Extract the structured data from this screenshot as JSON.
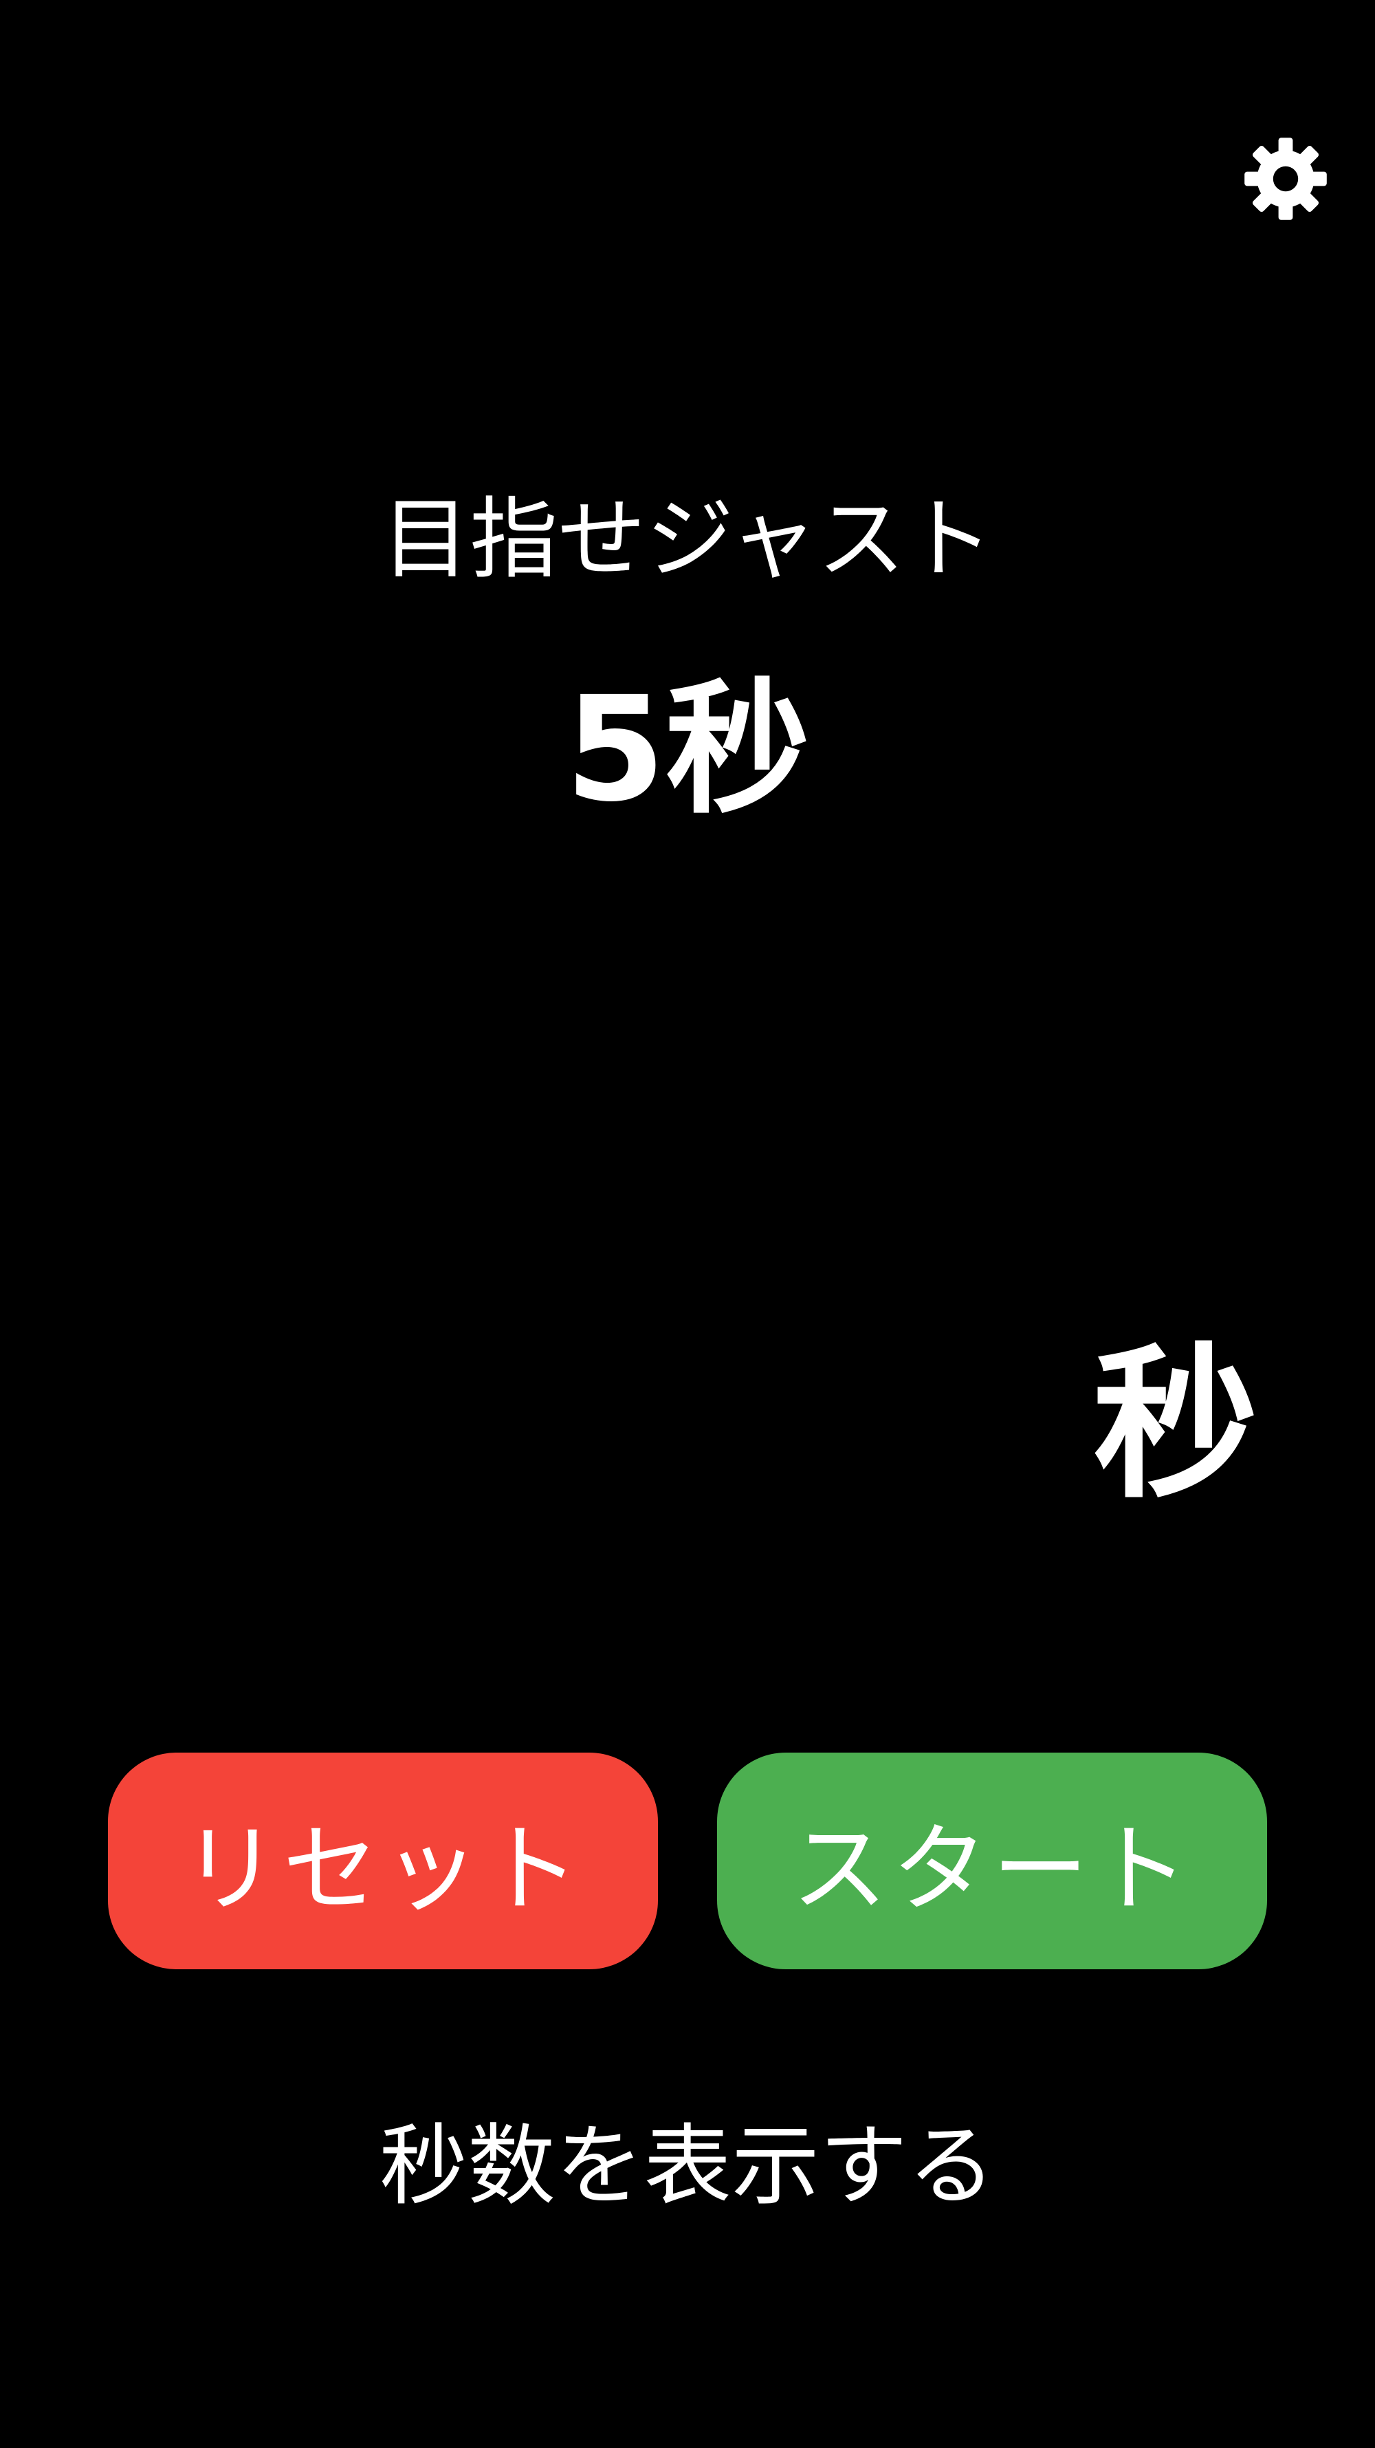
{
  "settings": {
    "icon": "gear-icon"
  },
  "goal": {
    "label": "目指せジャスト",
    "value": "5秒"
  },
  "timer": {
    "elapsed": "",
    "unit": "秒"
  },
  "buttons": {
    "reset_label": "リセット",
    "start_label": "スタート"
  },
  "toggle": {
    "show_seconds_label": "秒数を表示する"
  },
  "colors": {
    "background": "#000000",
    "text": "#ffffff",
    "reset": "#f44439",
    "start": "#4caf50"
  }
}
